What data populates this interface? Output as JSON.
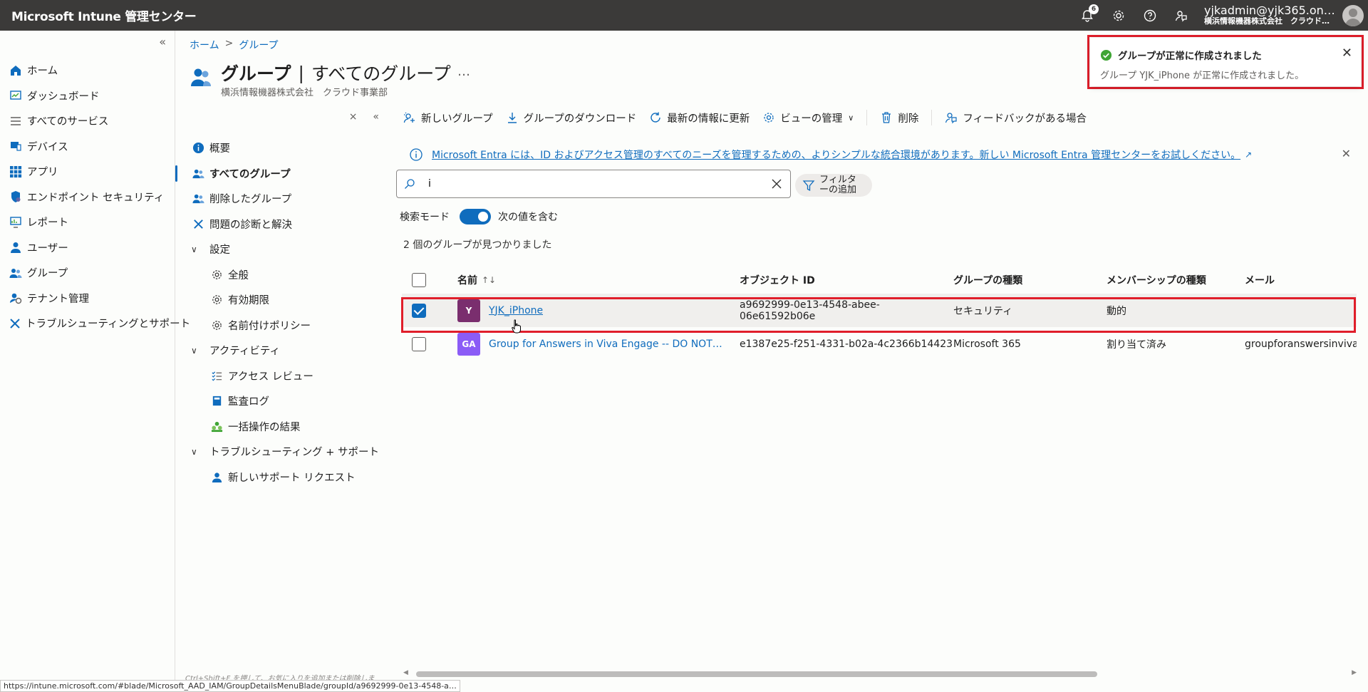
{
  "app": {
    "title": "Microsoft Intune 管理センター",
    "notification_count": "6",
    "user_name": "yjkadmin@yjk365.on…",
    "user_org": "横浜情報機器株式会社　クラウド…"
  },
  "leftnav": {
    "items": [
      {
        "label": "ホーム",
        "icon": "home-icon"
      },
      {
        "label": "ダッシュボード",
        "icon": "dashboard-icon"
      },
      {
        "label": "すべてのサービス",
        "icon": "list-icon"
      },
      {
        "label": "デバイス",
        "icon": "devices-icon"
      },
      {
        "label": "アプリ",
        "icon": "apps-grid-icon"
      },
      {
        "label": "エンドポイント セキュリティ",
        "icon": "shield-icon"
      },
      {
        "label": "レポート",
        "icon": "report-icon"
      },
      {
        "label": "ユーザー",
        "icon": "user-icon"
      },
      {
        "label": "グループ",
        "icon": "group-icon"
      },
      {
        "label": "テナント管理",
        "icon": "tenant-icon"
      },
      {
        "label": "トラブルシューティングとサポート",
        "icon": "wrench-icon"
      }
    ]
  },
  "breadcrumb": {
    "home": "ホーム",
    "current": "グループ"
  },
  "header": {
    "title": "グループ",
    "pipe": "|",
    "subtitle_main": "すべてのグループ",
    "more": "…",
    "org": "横浜情報機器株式会社　クラウド事業部"
  },
  "secmenu": {
    "items": [
      {
        "label": "概要"
      },
      {
        "label": "すべてのグループ"
      },
      {
        "label": "削除したグループ"
      },
      {
        "label": "問題の診断と解決"
      },
      {
        "label": "設定"
      },
      {
        "label": "全般"
      },
      {
        "label": "有効期限"
      },
      {
        "label": "名前付けポリシー"
      },
      {
        "label": "アクティビティ"
      },
      {
        "label": "アクセス レビュー"
      },
      {
        "label": "監査ログ"
      },
      {
        "label": "一括操作の結果"
      },
      {
        "label": "トラブルシューティング + サポート"
      },
      {
        "label": "新しいサポート リクエスト"
      }
    ],
    "shortcut_hint": "Ctrl+Shift+F を押して、お気に入りを追加または削除しま"
  },
  "toolbar": {
    "new_group": "新しいグループ",
    "download": "グループのダウンロード",
    "refresh": "最新の情報に更新",
    "manage_view": "ビューの管理",
    "delete": "削除",
    "feedback": "フィードバックがある場合"
  },
  "info_bar": {
    "text": "Microsoft Entra には、ID およびアクセス管理のすべてのニーズを管理するための、よりシンプルな統合環境があります。新しい Microsoft Entra 管理センターをお試しください。"
  },
  "search": {
    "value": "i",
    "filter_label_1": "フィルタ",
    "filter_label_2": "ーの追加",
    "mode_label": "検索モード",
    "mode_value": "次の値を含む"
  },
  "results": {
    "count_text": "2 個のグループが見つかりました"
  },
  "table": {
    "columns": [
      "名前",
      "オブジェクト ID",
      "グループの種類",
      "メンバーシップの種類",
      "メール"
    ],
    "rows": [
      {
        "initials": "Y",
        "name": "YJK_iPhone",
        "object_id": "a9692999-0e13-4548-abee-06e61592b06e",
        "group_type": "セキュリティ",
        "membership": "動的",
        "mail": "",
        "color": "#7a2e6e",
        "checked": true
      },
      {
        "initials": "GA",
        "name": "Group for Answers in Viva Engage -- DO NOT DELE…",
        "object_id": "e1387e25-f251-4331-b02a-4c2366b14423",
        "group_type": "Microsoft 365",
        "membership": "割り当て済み",
        "mail": "groupforanswersinvivaen",
        "color": "#8b5cf6",
        "checked": false
      }
    ]
  },
  "toast": {
    "title": "グループが正常に作成されました",
    "body": "グループ YJK_iPhone が正常に作成されました。"
  },
  "statusbar": {
    "url": "https://intune.microsoft.com/#blade/Microsoft_AAD_IAM/GroupDetailsMenuBlade/groupId/a9692999-0e13-4548-a…"
  },
  "colors": {
    "accent": "#0f6cbd",
    "highlight": "#e01e2a",
    "topbar": "#3b3a39",
    "success": "#3fa535"
  }
}
